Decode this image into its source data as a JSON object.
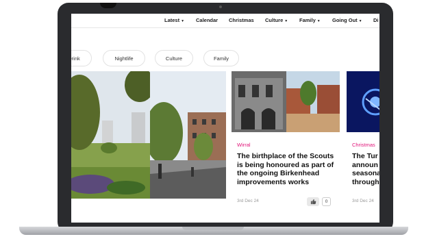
{
  "nav": {
    "items": [
      {
        "label": "Latest",
        "chevron": true
      },
      {
        "label": "Calendar",
        "chevron": false
      },
      {
        "label": "Christmas",
        "chevron": false
      },
      {
        "label": "Culture",
        "chevron": true
      },
      {
        "label": "Family",
        "chevron": true
      },
      {
        "label": "Going Out",
        "chevron": true
      },
      {
        "label": "Di",
        "chevron": false
      }
    ],
    "chevron_glyph": "▼"
  },
  "chips": [
    "Drink",
    "Nightlife",
    "Culture",
    "Family"
  ],
  "cards": [
    {
      "category": "Wirral",
      "title": "The birthplace of the Scouts is being honoured as part of the ongoing Birkenhead improvements works",
      "date": "3rd Dec 24",
      "likes": "0",
      "accent": "#e1157a"
    },
    {
      "category": "Christmas",
      "title": "The Tur announ seasona through",
      "date": "3rd Dec 24",
      "accent": "#e1157a"
    }
  ],
  "icons": {
    "like": "thumbs-up-icon"
  }
}
